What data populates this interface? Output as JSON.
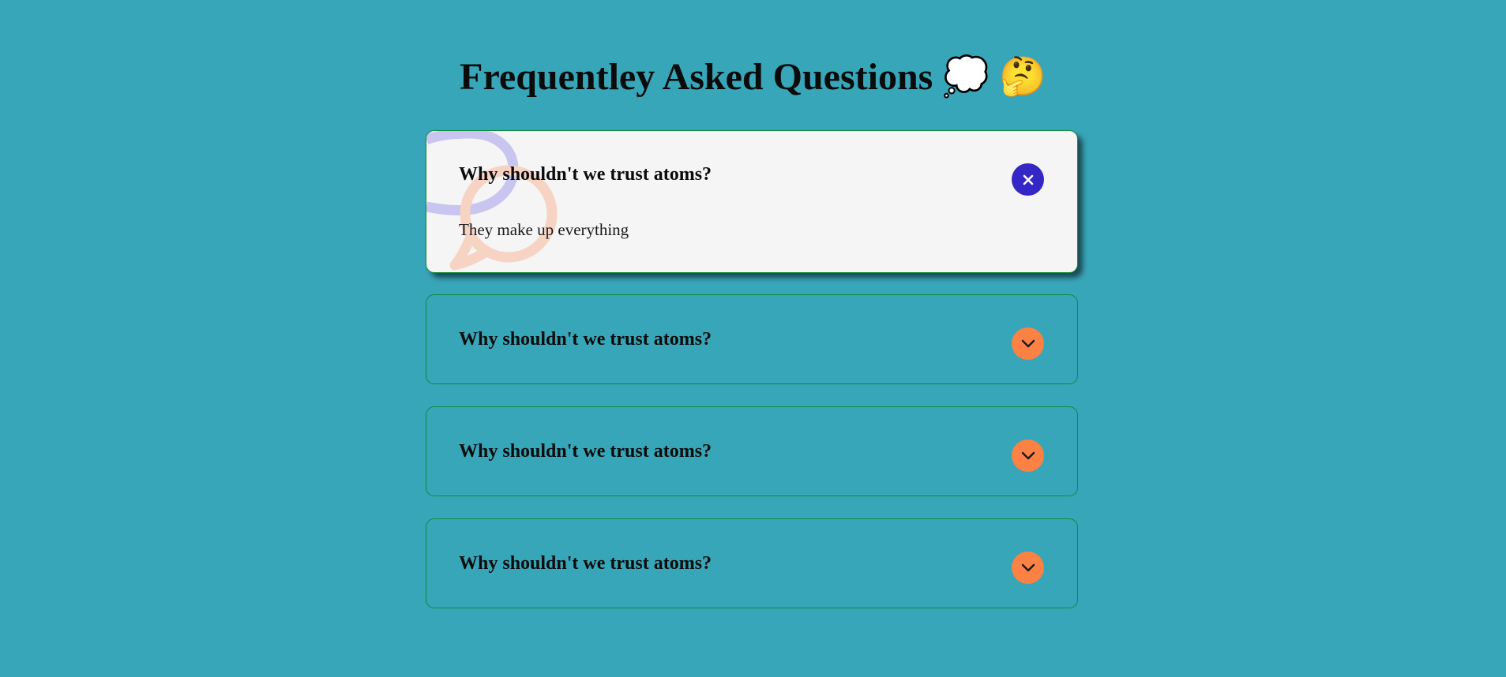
{
  "header": {
    "title": "Frequentley Asked Questions 💭 🤔"
  },
  "colors": {
    "background": "#38a6b9",
    "open_card": "#f5f5f5",
    "card_border": "#0f8a3a",
    "close_button": "#3427c6",
    "expand_button": "#fb8244"
  },
  "faq": {
    "items": [
      {
        "question": "Why shouldn't we trust atoms?",
        "answer": "They make up everything",
        "state": "open",
        "toggle_icon": "close-icon"
      },
      {
        "question": "Why shouldn't we trust atoms?",
        "state": "collapsed",
        "toggle_icon": "chevron-down-icon"
      },
      {
        "question": "Why shouldn't we trust atoms?",
        "state": "collapsed",
        "toggle_icon": "chevron-down-icon"
      },
      {
        "question": "Why shouldn't we trust atoms?",
        "state": "collapsed",
        "toggle_icon": "chevron-down-icon"
      }
    ]
  }
}
